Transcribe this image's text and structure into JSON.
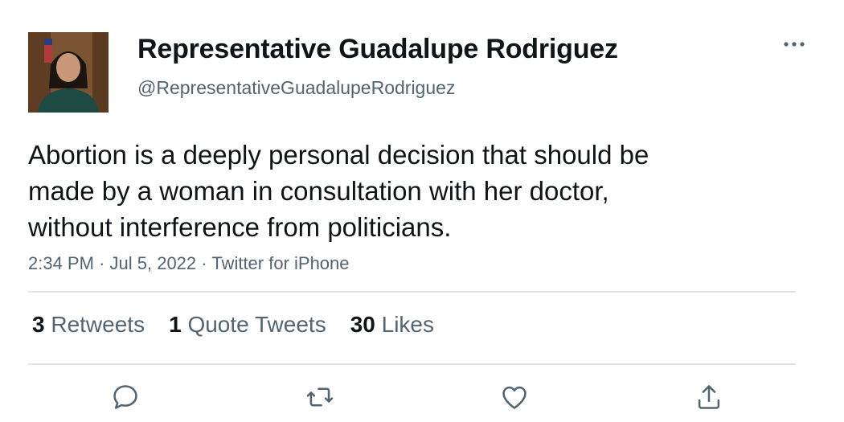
{
  "author": {
    "display_name": "Representative Guadalupe Rodriguez",
    "handle": "@RepresentativeGuadalupeRodriguez"
  },
  "tweet": {
    "lines": [
      "Abortion is a deeply personal decision that should be",
      "made by a woman in consultation with her doctor,",
      "without interference from politicians."
    ],
    "time": "2:34 PM",
    "separator": "·",
    "date": "Jul 5, 2022",
    "source": "Twitter for iPhone"
  },
  "stats": {
    "retweets_count": "3",
    "retweets_label": "Retweets",
    "quotes_count": "1",
    "quotes_label": "Quote Tweets",
    "likes_count": "30",
    "likes_label": "Likes"
  },
  "actions": [
    "reply-icon",
    "retweet-icon",
    "like-icon",
    "share-icon"
  ],
  "colors": {
    "text_primary": "#0f1419",
    "text_secondary": "#536471",
    "icon": "#536471",
    "divider": "#e1e4e6"
  }
}
